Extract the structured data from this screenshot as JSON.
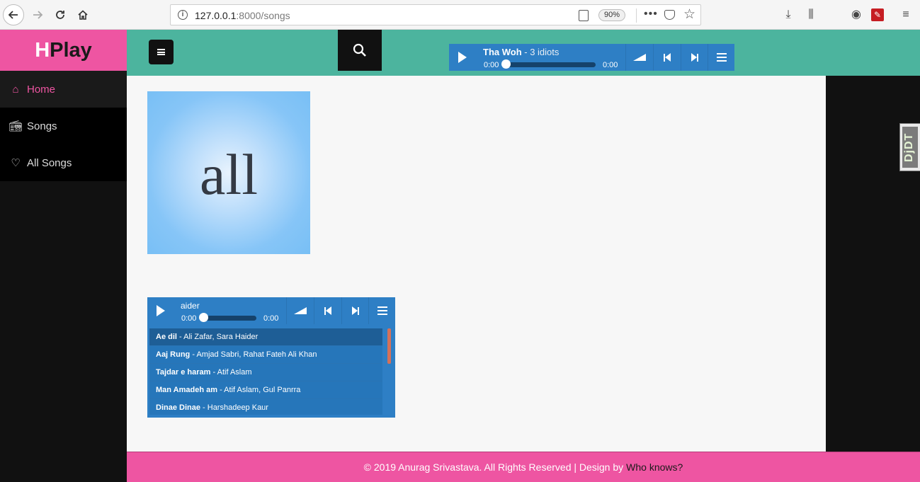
{
  "browser": {
    "url_host": "127.0.0.1",
    "url_rest": ":8000/songs",
    "zoom": "90%",
    "dots": "•••"
  },
  "brand": {
    "first": "H",
    "rest": "Play"
  },
  "sidebar": {
    "items": [
      {
        "label": "Home",
        "icon": "home-icon"
      },
      {
        "label": "Songs",
        "icon": "radio-icon"
      },
      {
        "label": "All Songs",
        "icon": "heart-icon"
      }
    ]
  },
  "header_player": {
    "title": "Tha Woh",
    "artist": " - 3 idiots",
    "time_current": "0:00",
    "time_total": "0:00",
    "progress": 0
  },
  "album": {
    "text": "all"
  },
  "main_player": {
    "title_fragment": "aider",
    "time_current": "0:00",
    "time_total": "0:00",
    "progress": 0,
    "playlist": [
      {
        "title": "Ae dil",
        "artist": " - Ali Zafar, Sara Haider"
      },
      {
        "title": "Aaj Rung",
        "artist": " - Amjad Sabri, Rahat Fateh Ali Khan"
      },
      {
        "title": "Tajdar e haram",
        "artist": " - Atif Aslam"
      },
      {
        "title": "Man Amadeh am",
        "artist": " - Atif Aslam, Gul Panrra"
      },
      {
        "title": "Dinae Dinae",
        "artist": " - Harshadeep Kaur"
      }
    ]
  },
  "djdt": {
    "label": "DjDT"
  },
  "footer": {
    "text": "© 2019 Anurag Srivastava. All Rights Reserved | Design by",
    "credit": "Who knows?"
  },
  "colors": {
    "brand_pink": "#ee55a2",
    "header_teal": "#4cb49e",
    "player_blue": "#2e7fc5",
    "sidebar_black": "#111111"
  }
}
